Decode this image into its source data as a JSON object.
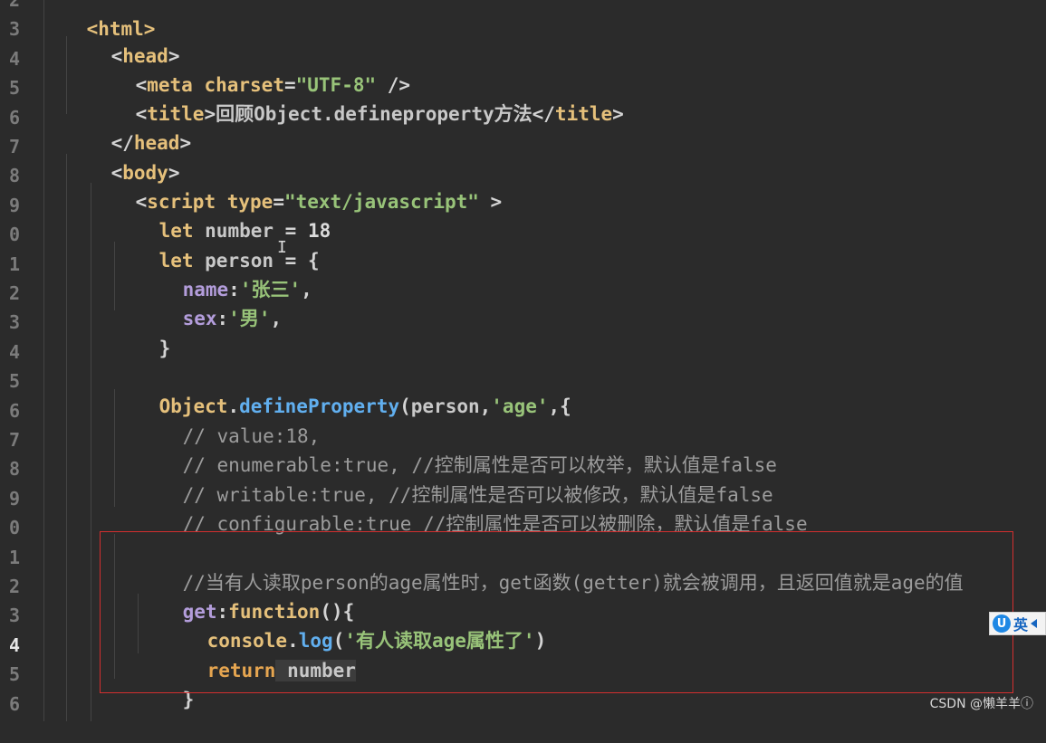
{
  "gutter": {
    "line_numbers": [
      "2",
      "3",
      "4",
      "5",
      "6",
      "7",
      "8",
      "9",
      "0",
      "1",
      "2",
      "3",
      "4",
      "5",
      "6",
      "7",
      "8",
      "9",
      "0",
      "1",
      "2",
      "3",
      "4",
      "5",
      "6"
    ],
    "active_line_index": 22
  },
  "code": {
    "l2": {
      "text": "<html>"
    },
    "l3": {
      "open": "<",
      "tag": "head",
      "close": ">"
    },
    "l4": {
      "open": "<",
      "tag": "meta",
      "attr": " charset",
      "eq": "=",
      "val": "\"UTF-8\"",
      "end": " />"
    },
    "l5": {
      "open": "<",
      "tag": "title",
      "close": ">",
      "text": "回顾Object.defineproperty方法",
      "etag_open": "</",
      "etag": "title",
      "etag_close": ">"
    },
    "l6": {
      "open": "</",
      "tag": "head",
      "close": ">"
    },
    "l7": {
      "open": "<",
      "tag": "body",
      "close": ">"
    },
    "l8": {
      "open": "<",
      "tag": "script",
      "attr": " type",
      "eq": "=",
      "val": "\"text/javascript\"",
      "end": " >"
    },
    "l9": {
      "kw": "let",
      "name": " number",
      "eq": " = ",
      "num": "18"
    },
    "l10": {
      "kw": "let",
      "name": " person",
      "eq": " = ",
      "brace": "{"
    },
    "l11": {
      "prop": "name",
      "colon": ":",
      "val": "'张三'",
      "comma": ","
    },
    "l12": {
      "prop": "sex",
      "colon": ":",
      "val": "'男'",
      "comma": ","
    },
    "l13": {
      "brace": "}"
    },
    "l15": {
      "obj": "Object",
      "dot": ".",
      "fn": "defineProperty",
      "paren": "(",
      "arg": "person",
      "comma": ",",
      "str": "'age'",
      "rest": ",{"
    },
    "l16": {
      "comment": "// value:18,"
    },
    "l17": {
      "comment": "// enumerable:true, //控制属性是否可以枚举，默认值是false"
    },
    "l18": {
      "comment": "// writable:true, //控制属性是否可以被修改，默认值是false"
    },
    "l19": {
      "comment": "// configurable:true //控制属性是否可以被删除，默认值是false"
    },
    "l21": {
      "comment": "//当有人读取person的age属性时，get函数(getter)就会被调用，且返回值就是age的值"
    },
    "l22": {
      "prop": "get",
      "colon": ":",
      "fn": "function",
      "rest": "(){"
    },
    "l23": {
      "obj": "console",
      "dot": ".",
      "fn": "log",
      "paren": "(",
      "str": "'有人读取age属性了'",
      "close": ")"
    },
    "l24": {
      "kw": "return",
      "name": " number"
    },
    "l25": {
      "brace": "}"
    }
  },
  "ime": {
    "label": "英"
  },
  "watermark": "CSDN @懒羊羊ⓘ"
}
